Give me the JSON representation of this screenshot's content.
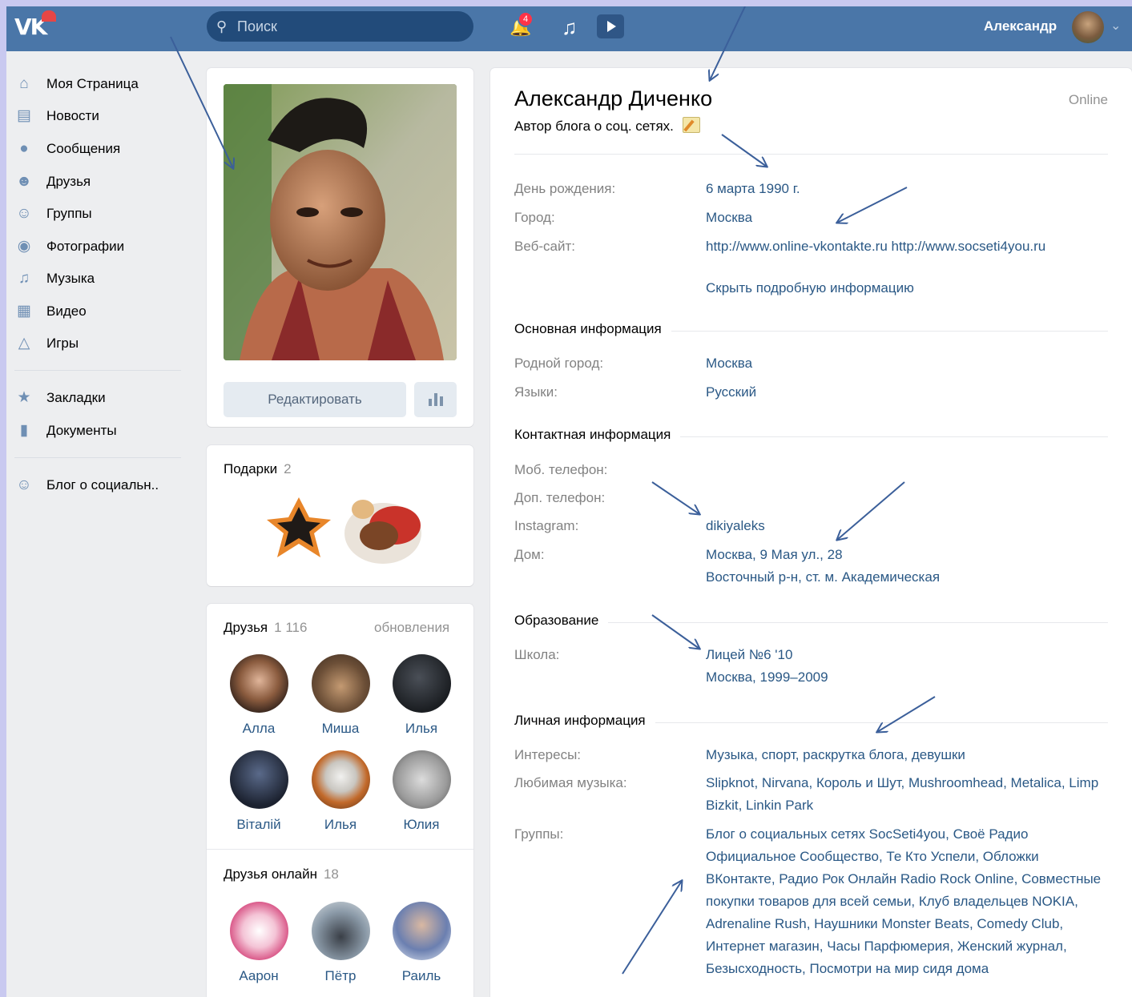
{
  "header": {
    "logo": "VK",
    "search_placeholder": "Поиск",
    "notifications_count": "4",
    "user_name": "Александр"
  },
  "sidebar": {
    "items": [
      {
        "label": "Моя Страница",
        "icon": "home-icon"
      },
      {
        "label": "Новости",
        "icon": "news-icon"
      },
      {
        "label": "Сообщения",
        "icon": "messages-icon"
      },
      {
        "label": "Друзья",
        "icon": "friends-icon"
      },
      {
        "label": "Группы",
        "icon": "groups-icon"
      },
      {
        "label": "Фотографии",
        "icon": "camera-icon"
      },
      {
        "label": "Музыка",
        "icon": "music-icon"
      },
      {
        "label": "Видео",
        "icon": "video-icon"
      },
      {
        "label": "Игры",
        "icon": "gamepad-icon"
      },
      {
        "label": "Закладки",
        "icon": "star-icon"
      },
      {
        "label": "Документы",
        "icon": "document-icon"
      },
      {
        "label": "Блог о социальн..",
        "icon": "community-icon"
      }
    ]
  },
  "profile_card": {
    "edit_button": "Редактировать"
  },
  "gifts": {
    "title": "Подарки",
    "count": "2"
  },
  "friends": {
    "title": "Друзья",
    "count": "1 116",
    "updates_link": "обновления",
    "list": [
      "Алла",
      "Миша",
      "Илья",
      "Віталій",
      "Илья",
      "Юлия"
    ]
  },
  "friends_online": {
    "title": "Друзья онлайн",
    "count": "18",
    "list": [
      "Аарон",
      "Пётр",
      "Раиль"
    ]
  },
  "profile": {
    "name": "Александр Диченко",
    "status": "Автор блога о соц. сетях.",
    "online": "Online",
    "birthday_label": "День рождения:",
    "birthday": "6 марта 1990 г.",
    "city_label": "Город:",
    "city": "Москва",
    "website_label": "Веб-сайт:",
    "website": "http://www.online-vkontakte.ru http://www.socseti4you.ru",
    "hide_details": "Скрыть подробную информацию",
    "main_info_title": "Основная информация",
    "hometown_label": "Родной город:",
    "hometown": "Москва",
    "languages_label": "Языки:",
    "languages": "Русский",
    "contact_title": "Контактная информация",
    "mobile_label": "Моб. телефон:",
    "extra_phone_label": "Доп. телефон:",
    "instagram_label": "Instagram:",
    "instagram": "dikiyaleks",
    "home_label": "Дом:",
    "home_line1": "Москва, 9 Мая ул., 28",
    "home_line2": "Восточный р-н, ст. м. Академическая",
    "education_title": "Образование",
    "school_label": "Школа:",
    "school": "Лицей №6 '10",
    "school_details": "Москва, 1999–2009",
    "personal_title": "Личная информация",
    "interests_label": "Интересы:",
    "interests": "Музыка, спорт, раскрутка блога, девушки",
    "music_label": "Любимая музыка:",
    "music": "Slipknot, Nirvana, Король и Шут, Mushroomhead, Metalica, Limp Bizkit, Linkin Park",
    "groups_label": "Группы:",
    "groups": "Блог о социальных сетях SocSeti4you, Своё Радио Официальное Сообщество, Те Кто Успели, Обложки ВКонтакте, Радио Рок Онлайн Radio Rock Online, Совместные покупки товаров для всей семьи, Клуб владельцев NOKIA, Adrenaline Rush, Наушники Monster Beats, Comedy Club, Интернет магазин, Часы Парфюмерия, Женский журнал, Безысходность, Посмотри на мир сидя дома"
  },
  "colors": {
    "header": "#4a76a8",
    "link": "#2a5885",
    "background": "#edeef0",
    "annotation_arrow": "#3b5f9a"
  }
}
